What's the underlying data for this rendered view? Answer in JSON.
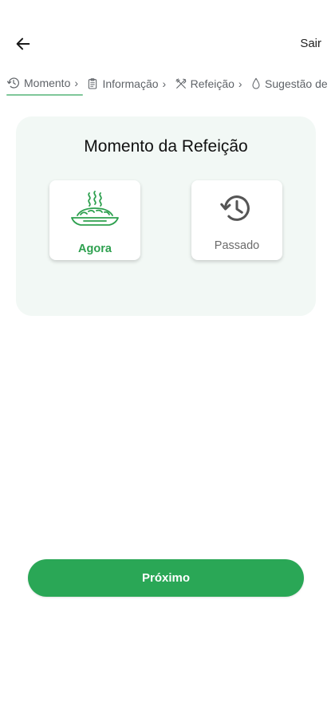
{
  "header": {
    "back_icon": "arrow-left-icon",
    "exit_label": "Sair"
  },
  "steps": [
    {
      "label": "Momento",
      "icon": "history-icon",
      "active": true
    },
    {
      "label": "Informação",
      "icon": "clipboard-icon",
      "active": false
    },
    {
      "label": "Refeição",
      "icon": "utensils-icon",
      "active": false
    },
    {
      "label": "Sugestão de D",
      "icon": "drop-icon",
      "active": false
    }
  ],
  "card": {
    "title": "Momento da Refeição",
    "options": [
      {
        "label": "Agora",
        "icon": "hot-dish-icon",
        "selected": true
      },
      {
        "label": "Passado",
        "icon": "history-icon",
        "selected": false
      }
    ]
  },
  "footer": {
    "next_label": "Próximo"
  },
  "colors": {
    "accent": "#2aa756",
    "accent_light": "#7fc79a",
    "card_background": "#f2f8f5",
    "muted_text": "#6b6b6b"
  }
}
